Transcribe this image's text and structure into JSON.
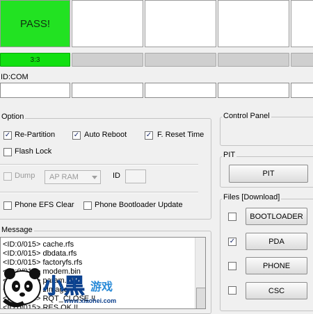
{
  "status": {
    "pass_label": "PASS!",
    "progress_label": "3:3"
  },
  "id_com_label": "ID:COM",
  "option": {
    "title": "Option",
    "re_partition": "Re-Partition",
    "auto_reboot": "Auto Reboot",
    "f_reset_time": "F. Reset Time",
    "flash_lock": "Flash Lock",
    "dump": "Dump",
    "dump_select": "AP RAM",
    "id_label": "ID",
    "phone_efs_clear": "Phone EFS Clear",
    "phone_bootloader_update": "Phone Bootloader Update"
  },
  "message": {
    "title": "Message",
    "lines": [
      "<ID:0/015> cache.rfs",
      "<ID:0/015> dbdata.rfs",
      "<ID:0/015> factoryfs.rfs",
      "<ID:0/015> modem.bin",
      "<ID:0/015> param.lfs",
      "<ID:0/015> zImage",
      "<ID:0/015> RQT_CLOSE !!",
      "<ID:0/015> RES OK !!"
    ]
  },
  "control_panel": {
    "title": "Control Panel"
  },
  "pit": {
    "title": "PIT",
    "button": "PIT"
  },
  "files": {
    "title": "Files [Download]",
    "bootloader": "BOOTLOADER",
    "pda": "PDA",
    "phone": "PHONE",
    "csc": "CSC"
  },
  "checkmark": "✓",
  "watermark": {
    "brand": "小黑游戏",
    "url": "www.xiaohei.com"
  }
}
